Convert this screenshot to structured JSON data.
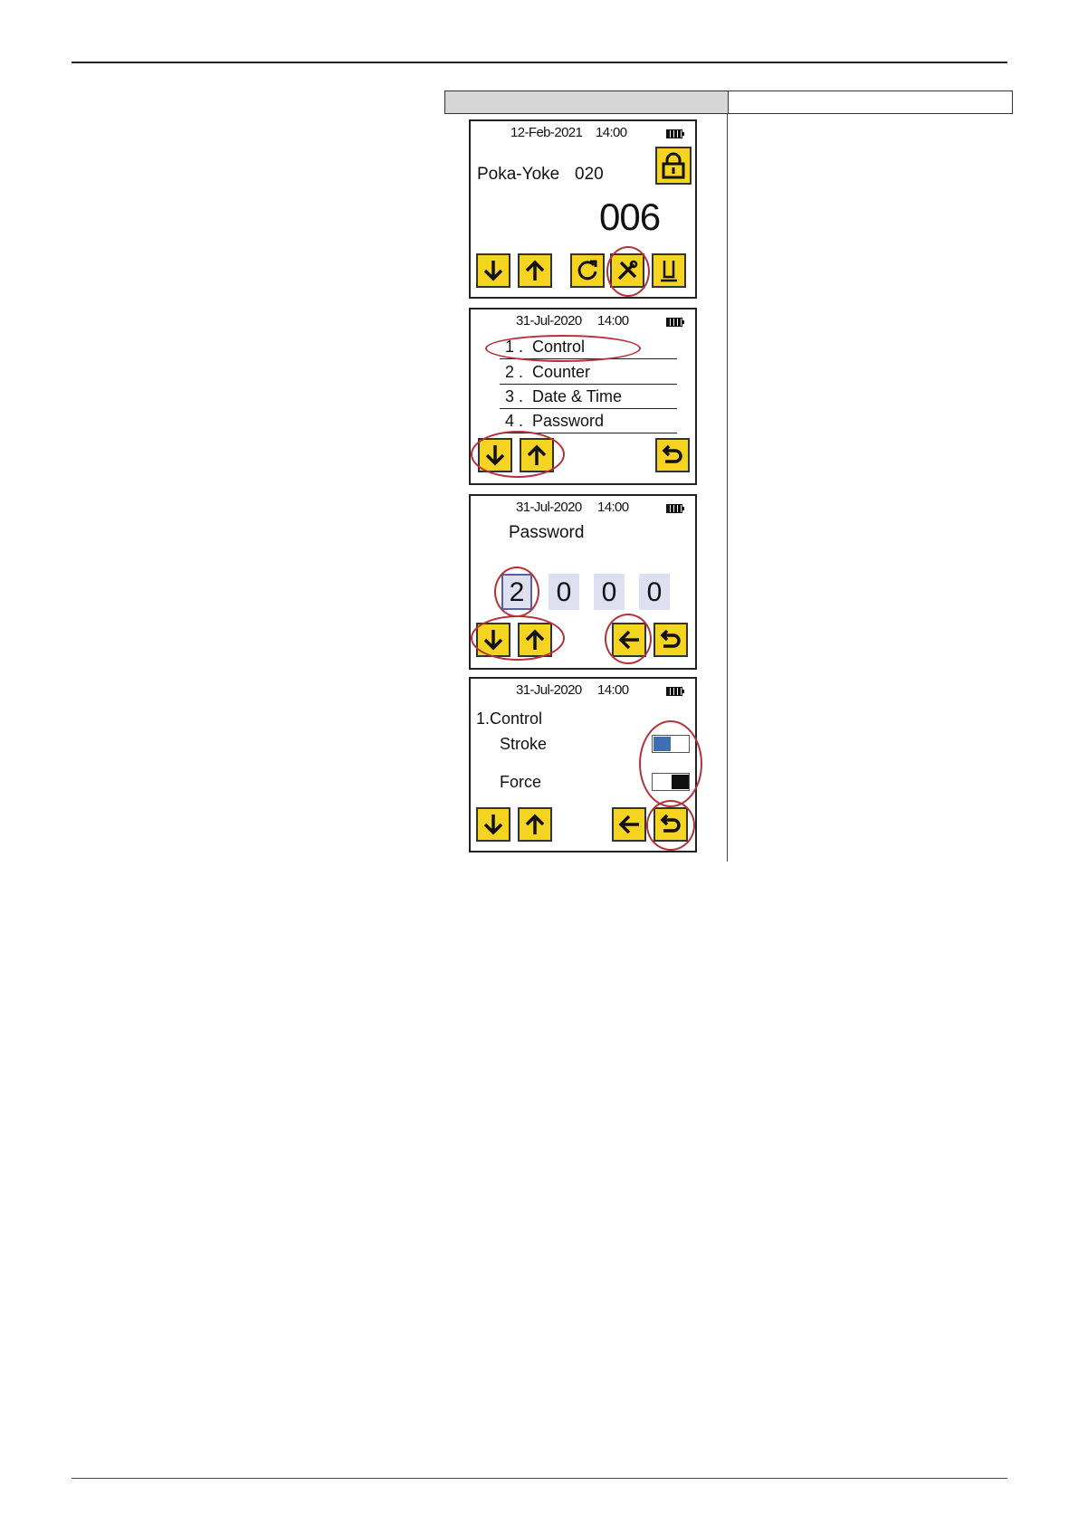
{
  "screen1": {
    "date": "12-Feb-2021",
    "time": "14:00",
    "label": "Poka-Yoke",
    "code": "020",
    "counter": "006",
    "icons": [
      "down-arrow-icon",
      "up-arrow-icon",
      "reset-icon",
      "tools-icon",
      "stand-icon",
      "lock-icon"
    ]
  },
  "screen2": {
    "date": "31-Jul-2020",
    "time": "14:00",
    "menu": [
      {
        "num": "1 .",
        "label": "Control"
      },
      {
        "num": "2 .",
        "label": "Counter"
      },
      {
        "num": "3 .",
        "label": "Date & Time"
      },
      {
        "num": "4 .",
        "label": "Password"
      }
    ]
  },
  "screen3": {
    "date": "31-Jul-2020",
    "time": "14:00",
    "title": "Password",
    "digits": [
      "2",
      "0",
      "0",
      "0"
    ]
  },
  "screen4": {
    "date": "31-Jul-2020",
    "time": "14:00",
    "title": "1.Control",
    "stroke_label": "Stroke",
    "force_label": "Force",
    "colors": {
      "toggle_on": "#3e6fb0",
      "toggle_off": "#111111",
      "button": "#f5d321",
      "highlight": "#b5303a"
    }
  }
}
